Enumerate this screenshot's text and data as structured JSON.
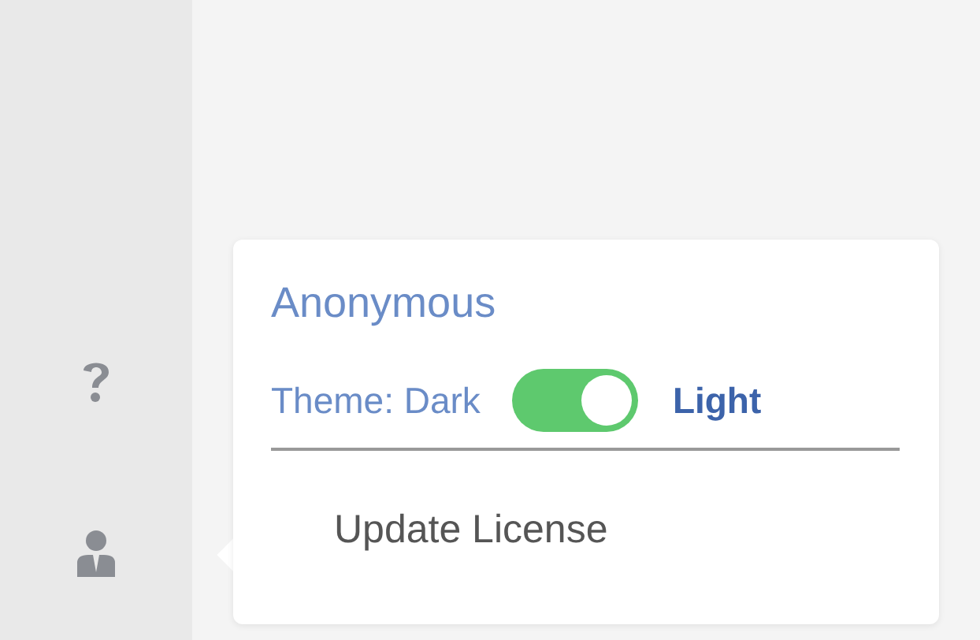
{
  "user_menu": {
    "user_name": "Anonymous",
    "theme": {
      "label_off": "Theme: Dark",
      "label_on": "Light",
      "on": true
    },
    "items": [
      {
        "label": "Update License"
      }
    ]
  }
}
